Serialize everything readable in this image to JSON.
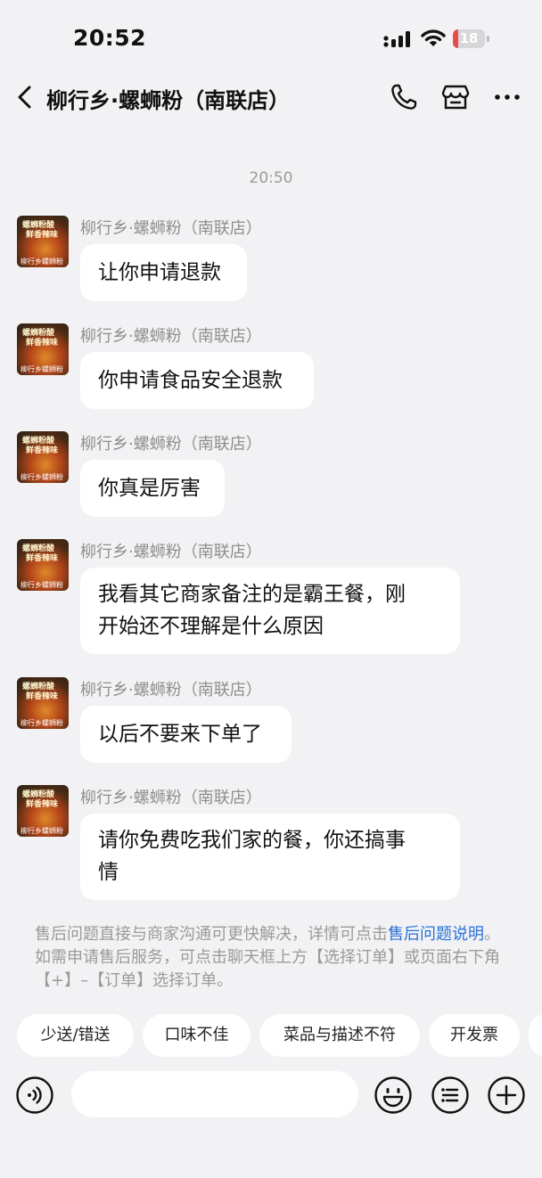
{
  "status": {
    "time": "20:52",
    "battery": "18",
    "battery_level": 0.18
  },
  "nav": {
    "title": "柳行乡·螺蛳粉（南联店）",
    "icons": [
      "back-arrow-icon",
      "phone-icon",
      "store-icon",
      "more-icon"
    ]
  },
  "chat": {
    "timestamp": "20:50",
    "avatar_text": {
      "line1": "螺蛳粉酸",
      "line2": "鲜香辣味",
      "line3": "柳行乡螺蛳粉"
    },
    "messages": [
      {
        "sender": "柳行乡·螺蛳粉（南联店）",
        "text": "让你申请退款"
      },
      {
        "sender": "柳行乡·螺蛳粉（南联店）",
        "text": "你申请食品安全退款"
      },
      {
        "sender": "柳行乡·螺蛳粉（南联店）",
        "text": "你真是厉害"
      },
      {
        "sender": "柳行乡·螺蛳粉（南联店）",
        "text_line1": "我看其它商家备注的是霸王餐，刚",
        "text_line2": "开始还不理解是什么原因"
      },
      {
        "sender": "柳行乡·螺蛳粉（南联店）",
        "text": "以后不要来下单了"
      },
      {
        "sender": "柳行乡·螺蛳粉（南联店）",
        "text_line1": "请你免费吃我们家的餐，你还搞事",
        "text_line2": "情"
      }
    ]
  },
  "notice": {
    "part1": "售后问题直接与商家沟通可更快解决，详情可点击",
    "link": "售后问题说明",
    "part2": "。如需申请售后服务，可点击聊天框上方【选择订单】或页面右下角【+】–【订单】选择订单。"
  },
  "quick_replies": [
    "少送/错送",
    "口味不佳",
    "菜品与描述不符",
    "开发票"
  ],
  "input": {
    "icons": [
      "voice-icon",
      "emoji-icon",
      "quick-phrase-icon",
      "plus-icon"
    ]
  },
  "colors": {
    "background": "#f2f2f4",
    "link": "#2a72d8",
    "battery_red": "#e84a4a"
  }
}
